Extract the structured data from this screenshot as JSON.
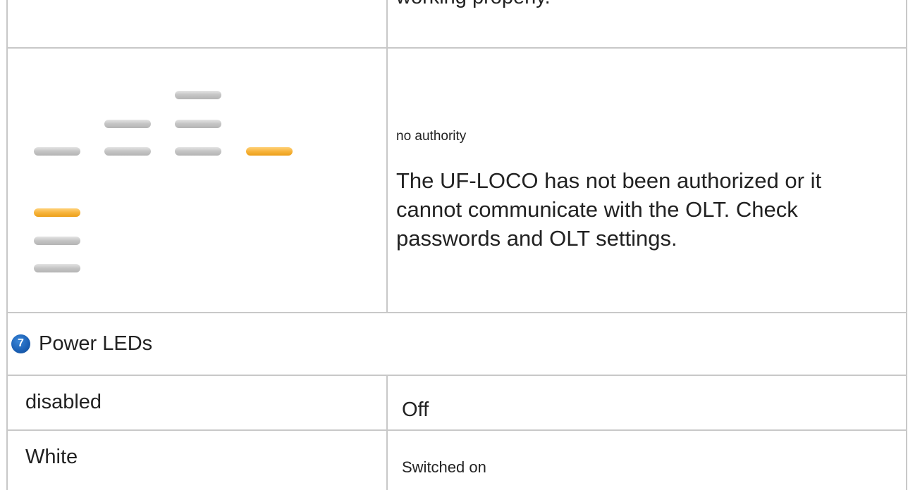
{
  "top_row": {
    "cut_text": "working properly."
  },
  "status_row": {
    "label": "no authority",
    "description": "The UF-LOCO has not been authorized or it cannot communicate with the OLT. Check passwords and OLT settings.",
    "led_colors": {
      "off": "#c4c4c4",
      "lit": "#f7b43c"
    }
  },
  "section": {
    "number": "7",
    "title": "Power LEDs",
    "badge_color": "#1a5fb4"
  },
  "rows": [
    {
      "state": "disabled",
      "meaning": "Off"
    },
    {
      "state": "White",
      "meaning": "Switched on"
    }
  ]
}
